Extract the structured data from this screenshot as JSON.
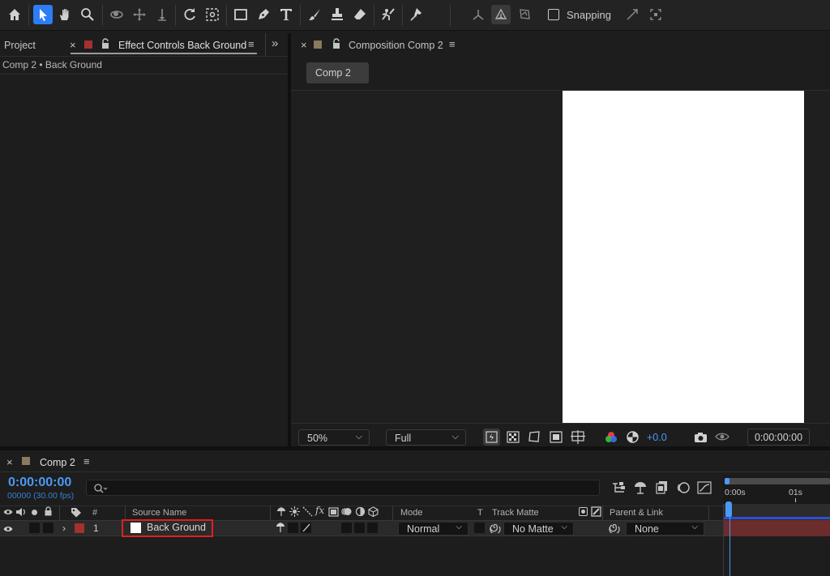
{
  "toolbar": {
    "snapping_label": "Snapping",
    "tools": [
      "home-icon",
      "selection-arrow-icon",
      "hand-icon",
      "zoom-icon",
      "orbit-camera-icon",
      "pan-camera-icon",
      "dolly-camera-icon",
      "rotate-icon",
      "anchor-point-icon",
      "rectangle-icon",
      "pen-icon",
      "type-icon",
      "brush-icon",
      "clone-stamp-icon",
      "eraser-icon",
      "roto-brush-icon",
      "puppet-pin-icon"
    ]
  },
  "left_panel": {
    "project_tab": "Project",
    "effect_controls_tab": "Effect Controls Back Ground",
    "breadcrumb": "Comp 2 • Back Ground",
    "more_glyph": "»"
  },
  "comp_panel": {
    "tab": "Composition Comp 2",
    "comp_button": "Comp 2",
    "zoom": "50%",
    "resolution": "Full",
    "exposure": "+0.0",
    "timecode": "0:00:00:00"
  },
  "timeline": {
    "tab": "Comp 2",
    "timecode": "0:00:00:00",
    "frames": "00000 (30.00 fps)",
    "search_placeholder": "",
    "headers": {
      "number": "#",
      "source_name": "Source Name",
      "mode": "Mode",
      "t": "T",
      "track_matte": "Track Matte",
      "parent_link": "Parent & Link"
    },
    "ruler": [
      "0:00s",
      "01s"
    ],
    "layers": [
      {
        "index": "1",
        "name": "Back Ground",
        "mode": "Normal",
        "track_matte": "No Matte",
        "parent": "None"
      }
    ]
  },
  "colors": {
    "accent_blue": "#2d7df6",
    "timecode_blue": "#4a9af5",
    "label_red": "#a3312e",
    "comp_swatch": "#8a7a5e",
    "highlight_box": "#e02020",
    "layer_bar": "#6b2c2c"
  }
}
